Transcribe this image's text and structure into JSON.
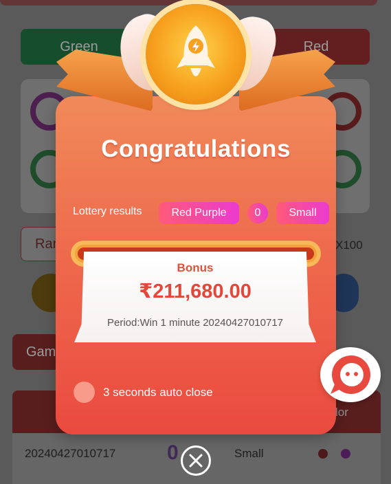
{
  "background": {
    "buttons": {
      "green": "Green",
      "red": "Red"
    },
    "random_fragment": "Ran",
    "multiplier": "X100",
    "history_tab_fragment": "Gam",
    "table_header_fragment": "lor",
    "history_row": {
      "period": "20240427010717",
      "number": "0",
      "size": "Small"
    }
  },
  "modal": {
    "title": "Congratulations",
    "lottery_results_label": "Lottery results",
    "result_color": "Red Purple",
    "result_number": "0",
    "result_size": "Small",
    "bonus_label": "Bonus",
    "bonus_amount": "₹211,680.00",
    "period_text": "Period:Win 1 minute 20240427010717",
    "auto_close_text": "3 seconds auto close"
  },
  "icons": {
    "medal": "rocket-icon",
    "close": "close-icon",
    "support": "chat-bubble-icon"
  },
  "colors": {
    "modal_top": "#f08a5a",
    "modal_bottom": "#ea4a3f",
    "bonus_red": "#e2483a",
    "pill_gradient_start": "#ff5a78",
    "pill_gradient_end": "#ea3ad0"
  }
}
